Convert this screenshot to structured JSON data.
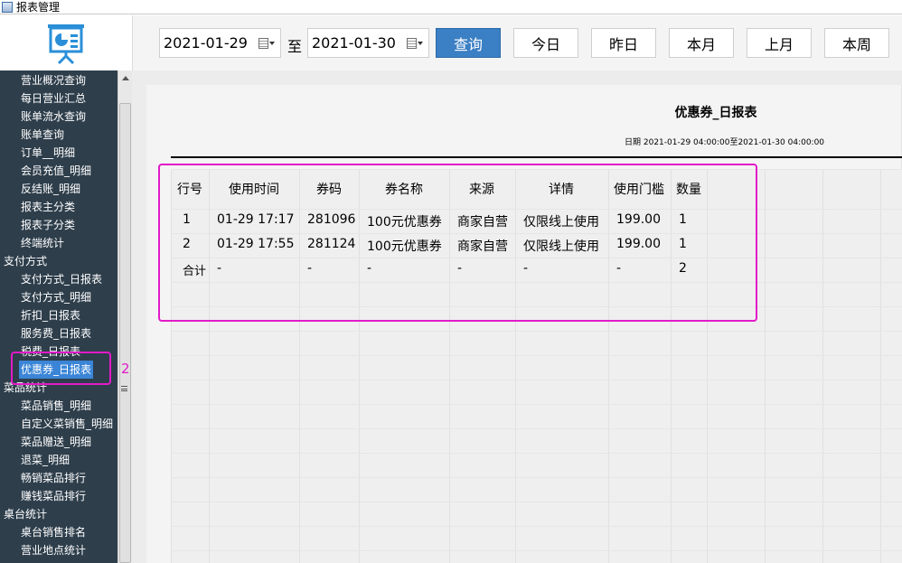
{
  "window": {
    "title": "报表管理"
  },
  "toolbar": {
    "date_from": "2021-01-29",
    "date_sep": "至",
    "date_to": "2021-01-30",
    "buttons": [
      "查询",
      "今日",
      "昨日",
      "本月",
      "上月",
      "本周"
    ]
  },
  "sidebar": {
    "items": [
      {
        "label": "营业概况查询",
        "level": 1
      },
      {
        "label": "每日营业汇总",
        "level": 1
      },
      {
        "label": "账单流水查询",
        "level": 1
      },
      {
        "label": "账单查询",
        "level": 1
      },
      {
        "label": "订单__明细",
        "level": 1
      },
      {
        "label": "会员充值_明细",
        "level": 1
      },
      {
        "label": "反结账_明细",
        "level": 1
      },
      {
        "label": "报表主分类",
        "level": 1
      },
      {
        "label": "报表子分类",
        "level": 1
      },
      {
        "label": "终端统计",
        "level": 1
      },
      {
        "label": "支付方式",
        "level": 0
      },
      {
        "label": "支付方式_日报表",
        "level": 1
      },
      {
        "label": "支付方式_明细",
        "level": 1
      },
      {
        "label": "折扣_日报表",
        "level": 1
      },
      {
        "label": "服务费_日报表",
        "level": 1
      },
      {
        "label": "税费_日报表",
        "level": 1
      },
      {
        "label": "优惠券_日报表",
        "level": 1,
        "active": true
      },
      {
        "label": "菜品统计",
        "level": 0
      },
      {
        "label": "菜品销售_明细",
        "level": 1
      },
      {
        "label": "自定义菜销售_明细",
        "level": 1
      },
      {
        "label": "菜品赠送_明细",
        "level": 1
      },
      {
        "label": "退菜_明细",
        "level": 1
      },
      {
        "label": "畅销菜品排行",
        "level": 1
      },
      {
        "label": "赚钱菜品排行",
        "level": 1
      },
      {
        "label": "桌台统计",
        "level": 0
      },
      {
        "label": "桌台销售排名",
        "level": 1
      },
      {
        "label": "营业地点统计",
        "level": 1
      }
    ]
  },
  "annotation": {
    "step": "2"
  },
  "report": {
    "title": "优惠券_日报表",
    "date_range": "日期 2021-01-29 04:00:00至2021-01-30 04:00:00",
    "columns": [
      "行号",
      "使用时间",
      "券码",
      "券名称",
      "来源",
      "详情",
      "使用门槛",
      "数量"
    ],
    "rows": [
      [
        "1",
        "01-29 17:17",
        "281096",
        "100元优惠券",
        "商家自营",
        "仅限线上使用",
        "199.00",
        "1"
      ],
      [
        "2",
        "01-29 17:55",
        "281124",
        "100元优惠券",
        "商家自营",
        "仅限线上使用",
        "199.00",
        "1"
      ],
      [
        "合计",
        "-",
        "-",
        "-",
        "-",
        "-",
        "-",
        "2"
      ]
    ]
  }
}
